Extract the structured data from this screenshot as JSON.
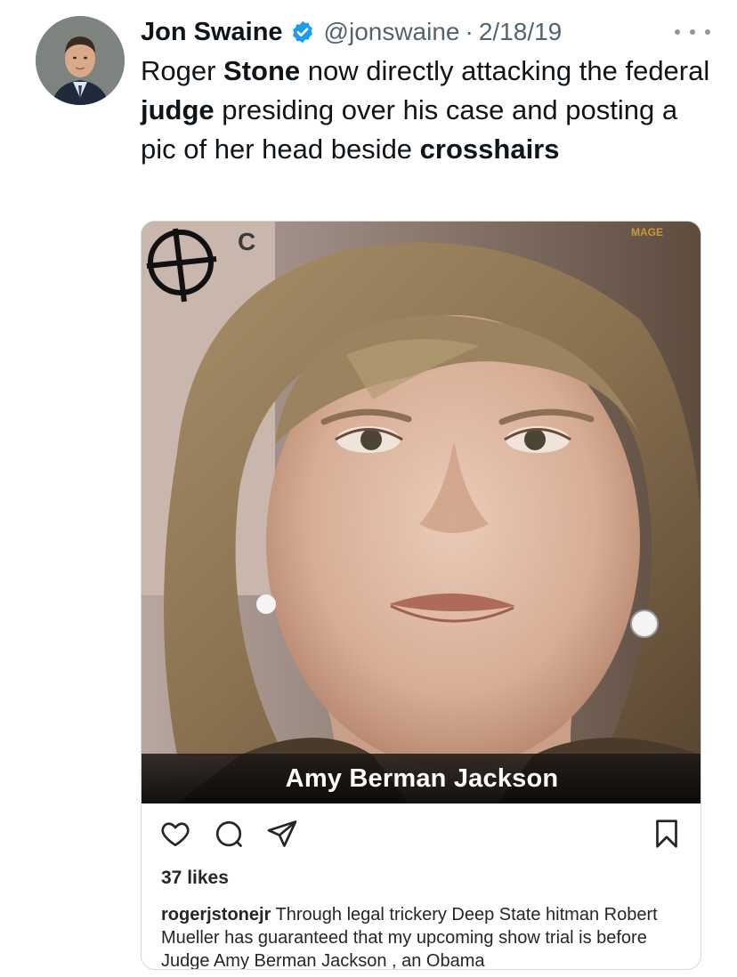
{
  "tweet": {
    "author_name": "Jon Swaine",
    "handle": "@jonswaine",
    "separator": "·",
    "date": "2/18/19",
    "text_parts": [
      {
        "text": "Roger ",
        "bold": false
      },
      {
        "text": "Stone",
        "bold": true
      },
      {
        "text": " now directly attacking the federal ",
        "bold": false
      },
      {
        "text": "judge",
        "bold": true
      },
      {
        "text": " presiding over his case and posting a pic of her head beside ",
        "bold": false
      },
      {
        "text": "crosshairs",
        "bold": true
      }
    ],
    "icons": {
      "verified": "verified-badge-icon",
      "more": "more-options-icon"
    },
    "colors": {
      "verified_blue": "#1d9bf0",
      "secondary_text": "#536471",
      "primary_text": "#0f1419"
    }
  },
  "embed": {
    "photo_caption": "Amy Berman Jackson",
    "photo_sign_letters": "C",
    "photo_corner_mark": "MAGE",
    "icons": [
      "heart-icon",
      "comment-icon",
      "share-icon",
      "bookmark-icon"
    ],
    "likes": "37 likes",
    "caption_user": "rogerjstonejr",
    "caption_text": " Through legal trickery Deep State hitman Robert Mueller has guaranteed that my upcoming show trial is before Judge Amy Berman Jackson , an Obama"
  }
}
